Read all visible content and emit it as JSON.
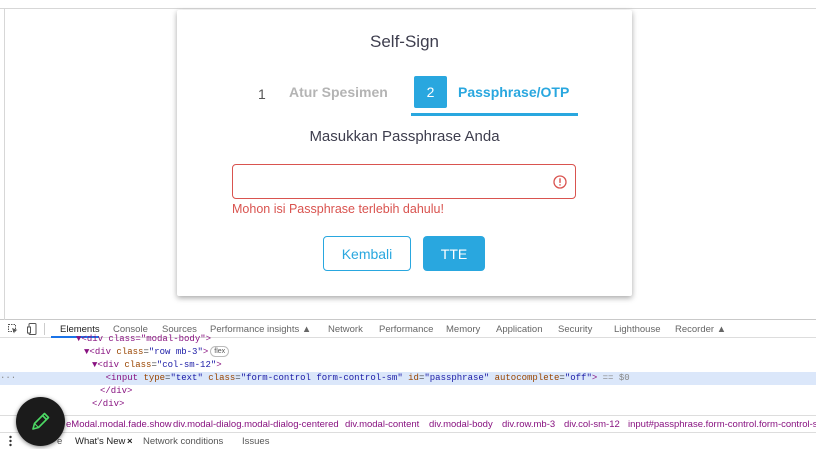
{
  "modal": {
    "title": "Self-Sign",
    "steps": [
      {
        "number": "1",
        "label": "Atur Spesimen",
        "state": "inactive"
      },
      {
        "number": "2",
        "label": "Passphrase/OTP",
        "state": "active"
      }
    ],
    "prompt": "Masukkan Passphrase Anda",
    "passphrase_value": "",
    "passphrase_placeholder": "",
    "error_message": "Mohon isi Passphrase terlebih dahulu!",
    "back_label": "Kembali",
    "submit_label": "TTE"
  },
  "devtools": {
    "tabs": [
      "Elements",
      "Console",
      "Sources",
      "Performance insights ▲",
      "Network",
      "Performance",
      "Memory",
      "Application",
      "Security",
      "Lighthouse",
      "Recorder ▲"
    ],
    "dom": {
      "line1": "div class=\"modal-body\"",
      "line2_tag": "div",
      "line2_attr": "class",
      "line2_val": "row mb-3",
      "line2_badge": "flex",
      "line3_tag": "div",
      "line3_attr": "class",
      "line3_val": "col-sm-12",
      "line4_tag": "input",
      "line4_type": "text",
      "line4_class": "form-control form-control-sm",
      "line4_id": "passphrase",
      "line4_autocomplete": "off",
      "line4_suffix": "== $0",
      "line5": "</div>",
      "line6": "</div>"
    },
    "breadcrumb": [
      "eModal.modal.fade.show",
      "div.modal-dialog.modal-dialog-centered",
      "div.modal-content",
      "div.modal-body",
      "div.row.mb-3",
      "div.col-sm-12",
      "input#passphrase.form-control.form-control-sm"
    ],
    "drawer_tabs": [
      "e",
      "What's New",
      "Network conditions",
      "Issues"
    ],
    "drawer_close": "×"
  },
  "colors": {
    "accent": "#29a7df",
    "error": "#d9534f"
  },
  "icons": {
    "error": "exclamation-circle-icon",
    "pencil": "pencil-icon",
    "inspect": "inspect-element-icon",
    "device": "device-toolbar-icon"
  }
}
